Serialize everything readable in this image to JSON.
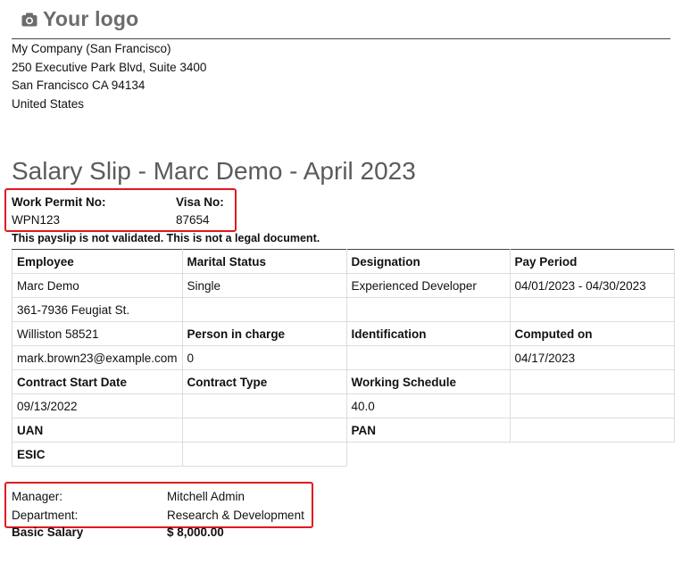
{
  "header": {
    "logo_text": "Your logo",
    "logo_icon": "camera-icon"
  },
  "company": {
    "name": "My Company (San Francisco)",
    "street": "250 Executive Park Blvd, Suite 3400",
    "city": "San Francisco CA 94134",
    "country": "United States"
  },
  "slip": {
    "title": "Salary Slip - Marc Demo - April 2023",
    "work_permit_label": "Work Permit No:",
    "work_permit_value": "WPN123",
    "visa_label": "Visa No:",
    "visa_value": "87654",
    "warning": "This payslip is not validated. This is not a legal document."
  },
  "table": {
    "rows": [
      [
        "Employee",
        "Marital Status",
        "Designation",
        "Pay Period"
      ],
      [
        "Marc Demo",
        "Single",
        "Experienced Developer",
        "04/01/2023 - 04/30/2023"
      ],
      [
        "361-7936 Feugiat St.",
        "",
        "",
        ""
      ],
      [
        "Williston 58521",
        "Person in charge",
        "Identification",
        "Computed on"
      ],
      [
        "mark.brown23@example.com",
        "0",
        "",
        "04/17/2023"
      ],
      [
        "Contract Start Date",
        "Contract Type",
        "Working Schedule",
        ""
      ],
      [
        "09/13/2022",
        "",
        "40.0",
        ""
      ],
      [
        "UAN",
        "",
        "PAN",
        ""
      ],
      [
        "ESIC",
        "",
        "",
        ""
      ]
    ]
  },
  "details": {
    "manager_label": "Manager:",
    "manager_value": "Mitchell Admin",
    "department_label": "Department:",
    "department_value": "Research & Development",
    "basic_salary_label": "Basic Salary",
    "basic_salary_value": "$ 8,000.00"
  },
  "colors": {
    "highlight": "#e1191e",
    "title": "#5b5b5b",
    "logo": "#6c6c6c"
  }
}
